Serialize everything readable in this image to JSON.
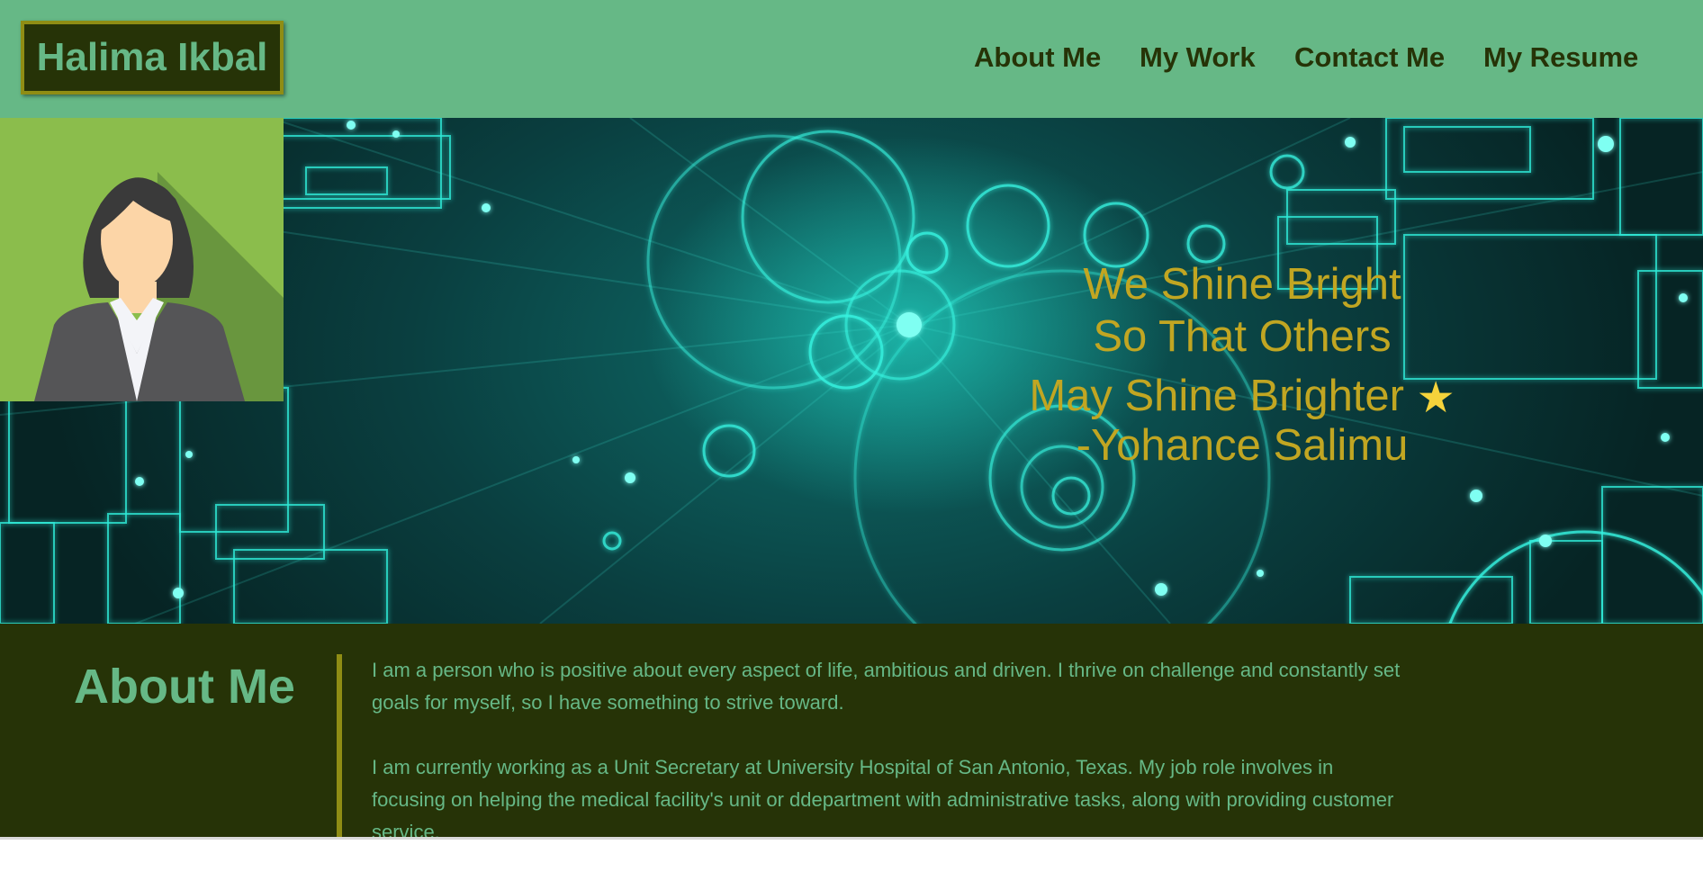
{
  "header": {
    "logo_text": "Halima Ikbal",
    "nav": [
      {
        "label": "About Me"
      },
      {
        "label": "My Work"
      },
      {
        "label": "Contact Me"
      },
      {
        "label": "My Resume"
      }
    ]
  },
  "hero": {
    "quote_lines": [
      "We Shine Bright",
      "So That Others",
      "May Shine Brighter"
    ],
    "quote_icon": "star-icon",
    "author": "-Yohance Salimu",
    "avatar_icon": "woman-avatar-icon"
  },
  "about": {
    "title": "About Me",
    "paragraphs": [
      "I am a person who is positive about every aspect of life, ambitious and driven. I thrive on challenge and constantly set goals for myself, so I have something to strive toward.",
      "I am currently working as a Unit Secretary at University Hospital of San Antonio, Texas. My job role involves in focusing on helping the medical facility's unit or ddepartment with administrative tasks, along with providing customer service."
    ]
  },
  "colors": {
    "header_bg": "#66b886",
    "dark_green": "#263307",
    "olive_accent": "#8f8d14",
    "quote_gold": "#c1a622",
    "star_yellow": "#f5d33b",
    "avatar_bg": "#8bbd4c"
  }
}
